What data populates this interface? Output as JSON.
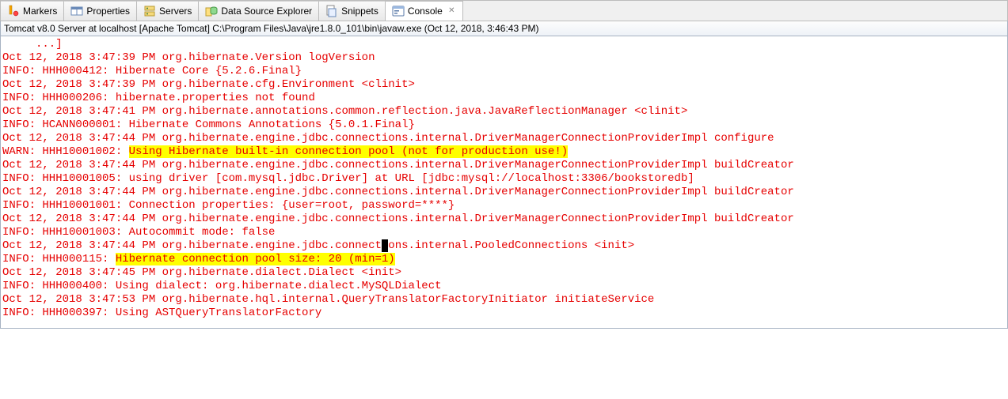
{
  "tabs": [
    {
      "label": "Markers",
      "icon": "bookmark-icon"
    },
    {
      "label": "Properties",
      "icon": "properties-icon"
    },
    {
      "label": "Servers",
      "icon": "servers-icon"
    },
    {
      "label": "Data Source Explorer",
      "icon": "datasource-icon"
    },
    {
      "label": "Snippets",
      "icon": "snippet-icon"
    },
    {
      "label": "Console",
      "icon": "console-icon",
      "active": true,
      "closable": true
    }
  ],
  "header": {
    "text": "Tomcat v8.0 Server at localhost [Apache Tomcat] C:\\Program Files\\Java\\jre1.8.0_101\\bin\\javaw.exe (Oct 12, 2018, 3:46:43 PM)"
  },
  "console": {
    "lines": [
      {
        "segments": [
          {
            "t": "     ...]"
          }
        ]
      },
      {
        "segments": [
          {
            "t": "Oct 12, 2018 3:47:39 PM org.hibernate.Version logVersion"
          }
        ]
      },
      {
        "segments": [
          {
            "t": "INFO: HHH000412: Hibernate Core {5.2.6.Final}"
          }
        ]
      },
      {
        "segments": [
          {
            "t": "Oct 12, 2018 3:47:39 PM org.hibernate.cfg.Environment <clinit>"
          }
        ]
      },
      {
        "segments": [
          {
            "t": "INFO: HHH000206: hibernate.properties not found"
          }
        ]
      },
      {
        "segments": [
          {
            "t": "Oct 12, 2018 3:47:41 PM org.hibernate.annotations.common.reflection.java.JavaReflectionManager <clinit>"
          }
        ]
      },
      {
        "segments": [
          {
            "t": "INFO: HCANN000001: Hibernate Commons Annotations {5.0.1.Final}"
          }
        ]
      },
      {
        "segments": [
          {
            "t": "Oct 12, 2018 3:47:44 PM org.hibernate.engine.jdbc.connections.internal.DriverManagerConnectionProviderImpl configure"
          }
        ]
      },
      {
        "segments": [
          {
            "t": "WARN: HHH10001002: "
          },
          {
            "t": "Using Hibernate built-in connection pool (not for production use!)",
            "hl": true
          }
        ]
      },
      {
        "segments": [
          {
            "t": "Oct 12, 2018 3:47:44 PM org.hibernate.engine.jdbc.connections.internal.DriverManagerConnectionProviderImpl buildCreator"
          }
        ]
      },
      {
        "segments": [
          {
            "t": "INFO: HHH10001005: using driver [com.mysql.jdbc.Driver] at URL [jdbc:mysql://localhost:3306/bookstoredb]"
          }
        ]
      },
      {
        "segments": [
          {
            "t": "Oct 12, 2018 3:47:44 PM org.hibernate.engine.jdbc.connections.internal.DriverManagerConnectionProviderImpl buildCreator"
          }
        ]
      },
      {
        "segments": [
          {
            "t": "INFO: HHH10001001: Connection properties: {user=root, password=****}"
          }
        ]
      },
      {
        "segments": [
          {
            "t": "Oct 12, 2018 3:47:44 PM org.hibernate.engine.jdbc.connections.internal.DriverManagerConnectionProviderImpl buildCreator"
          }
        ]
      },
      {
        "segments": [
          {
            "t": "INFO: HHH10001003: Autocommit mode: false"
          }
        ]
      },
      {
        "segments": [
          {
            "t": "Oct 12, 2018 3:47:44 PM org.hibernate.engine.jdbc.connect"
          },
          {
            "t": "i",
            "caret": true
          },
          {
            "t": "ons.internal.PooledConnections <init>"
          }
        ]
      },
      {
        "segments": [
          {
            "t": "INFO: HHH000115: "
          },
          {
            "t": "Hibernate connection pool size: 20 (min=1)",
            "hl": true
          }
        ]
      },
      {
        "segments": [
          {
            "t": "Oct 12, 2018 3:47:45 PM org.hibernate.dialect.Dialect <init>"
          }
        ]
      },
      {
        "segments": [
          {
            "t": "INFO: HHH000400: Using dialect: org.hibernate.dialect.MySQLDialect"
          }
        ]
      },
      {
        "segments": [
          {
            "t": "Oct 12, 2018 3:47:53 PM org.hibernate.hql.internal.QueryTranslatorFactoryInitiator initiateService"
          }
        ]
      },
      {
        "segments": [
          {
            "t": "INFO: HHH000397: Using ASTQueryTranslatorFactory"
          }
        ]
      }
    ]
  }
}
